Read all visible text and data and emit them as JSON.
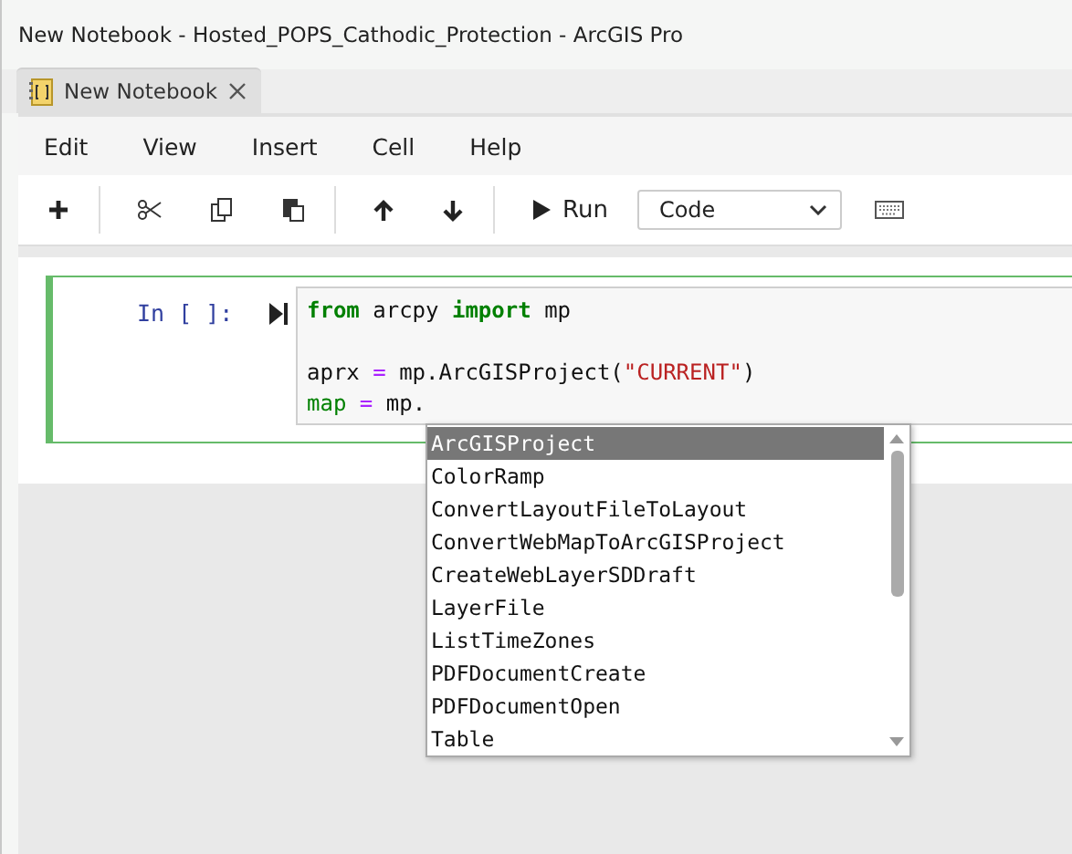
{
  "window": {
    "title": "New Notebook - Hosted_POPS_Cathodic_Protection - ArcGIS Pro"
  },
  "tabs": [
    {
      "label": "New Notebook",
      "selected": true
    }
  ],
  "menu": [
    "Edit",
    "View",
    "Insert",
    "Cell",
    "Help"
  ],
  "toolbar": {
    "run_label": "Run",
    "cell_type": "Code"
  },
  "cell": {
    "prompt": "In [ ]:",
    "lines": [
      {
        "kind": "code",
        "tokens": [
          {
            "kind": "keyword",
            "text": "from"
          },
          {
            "kind": "plain",
            "text": " arcpy "
          },
          {
            "kind": "keyword",
            "text": "import"
          },
          {
            "kind": "plain",
            "text": " mp"
          }
        ]
      },
      {
        "kind": "blank"
      },
      {
        "kind": "code",
        "tokens": [
          {
            "kind": "plain",
            "text": "aprx "
          },
          {
            "kind": "operator",
            "text": "="
          },
          {
            "kind": "plain",
            "text": " mp.ArcGISProject("
          },
          {
            "kind": "string",
            "text": "\"CURRENT\""
          },
          {
            "kind": "plain",
            "text": ")"
          }
        ]
      },
      {
        "kind": "code",
        "tokens": [
          {
            "kind": "variable",
            "text": "map"
          },
          {
            "kind": "operator",
            "text": " ="
          },
          {
            "kind": "plain",
            "text": " mp."
          }
        ]
      }
    ]
  },
  "completions": [
    {
      "label": "ArcGISProject",
      "selected": true
    },
    {
      "label": "ColorRamp",
      "selected": false
    },
    {
      "label": "ConvertLayoutFileToLayout",
      "selected": false
    },
    {
      "label": "ConvertWebMapToArcGISProject",
      "selected": false
    },
    {
      "label": "CreateWebLayerSDDraft",
      "selected": false
    },
    {
      "label": "LayerFile",
      "selected": false
    },
    {
      "label": "ListTimeZones",
      "selected": false
    },
    {
      "label": "PDFDocumentCreate",
      "selected": false
    },
    {
      "label": "PDFDocumentOpen",
      "selected": false
    },
    {
      "label": "Table",
      "selected": false
    }
  ]
}
